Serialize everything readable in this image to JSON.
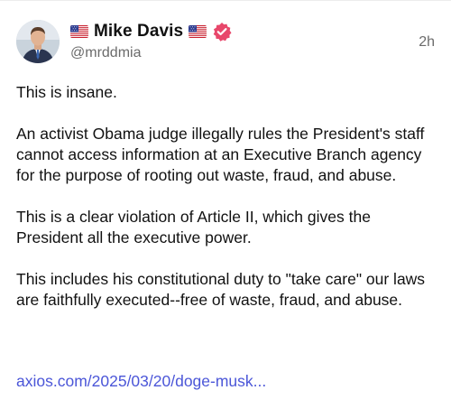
{
  "author": {
    "display_name": "Mike Davis",
    "handle": "@mrddmia",
    "flag_emoji": "us-flag-icon",
    "verified": true
  },
  "post": {
    "timestamp": "2h",
    "paragraphs": [
      "This is insane.",
      "An activist Obama judge illegally rules the President's staff cannot access information at an Executive Branch agency for the purpose of rooting out waste, fraud, and abuse.",
      "This is a clear violation of Article II, which gives the President all the executive power.",
      "This includes his constitutional duty to \"take care\" our laws are faithfully executed--free of waste, fraud, and abuse."
    ],
    "link_text": "axios.com/2025/03/20/doge-musk..."
  },
  "colors": {
    "link": "#4b56d8",
    "verified_badge": "#e8476b",
    "muted_text": "#6b6b6b"
  }
}
